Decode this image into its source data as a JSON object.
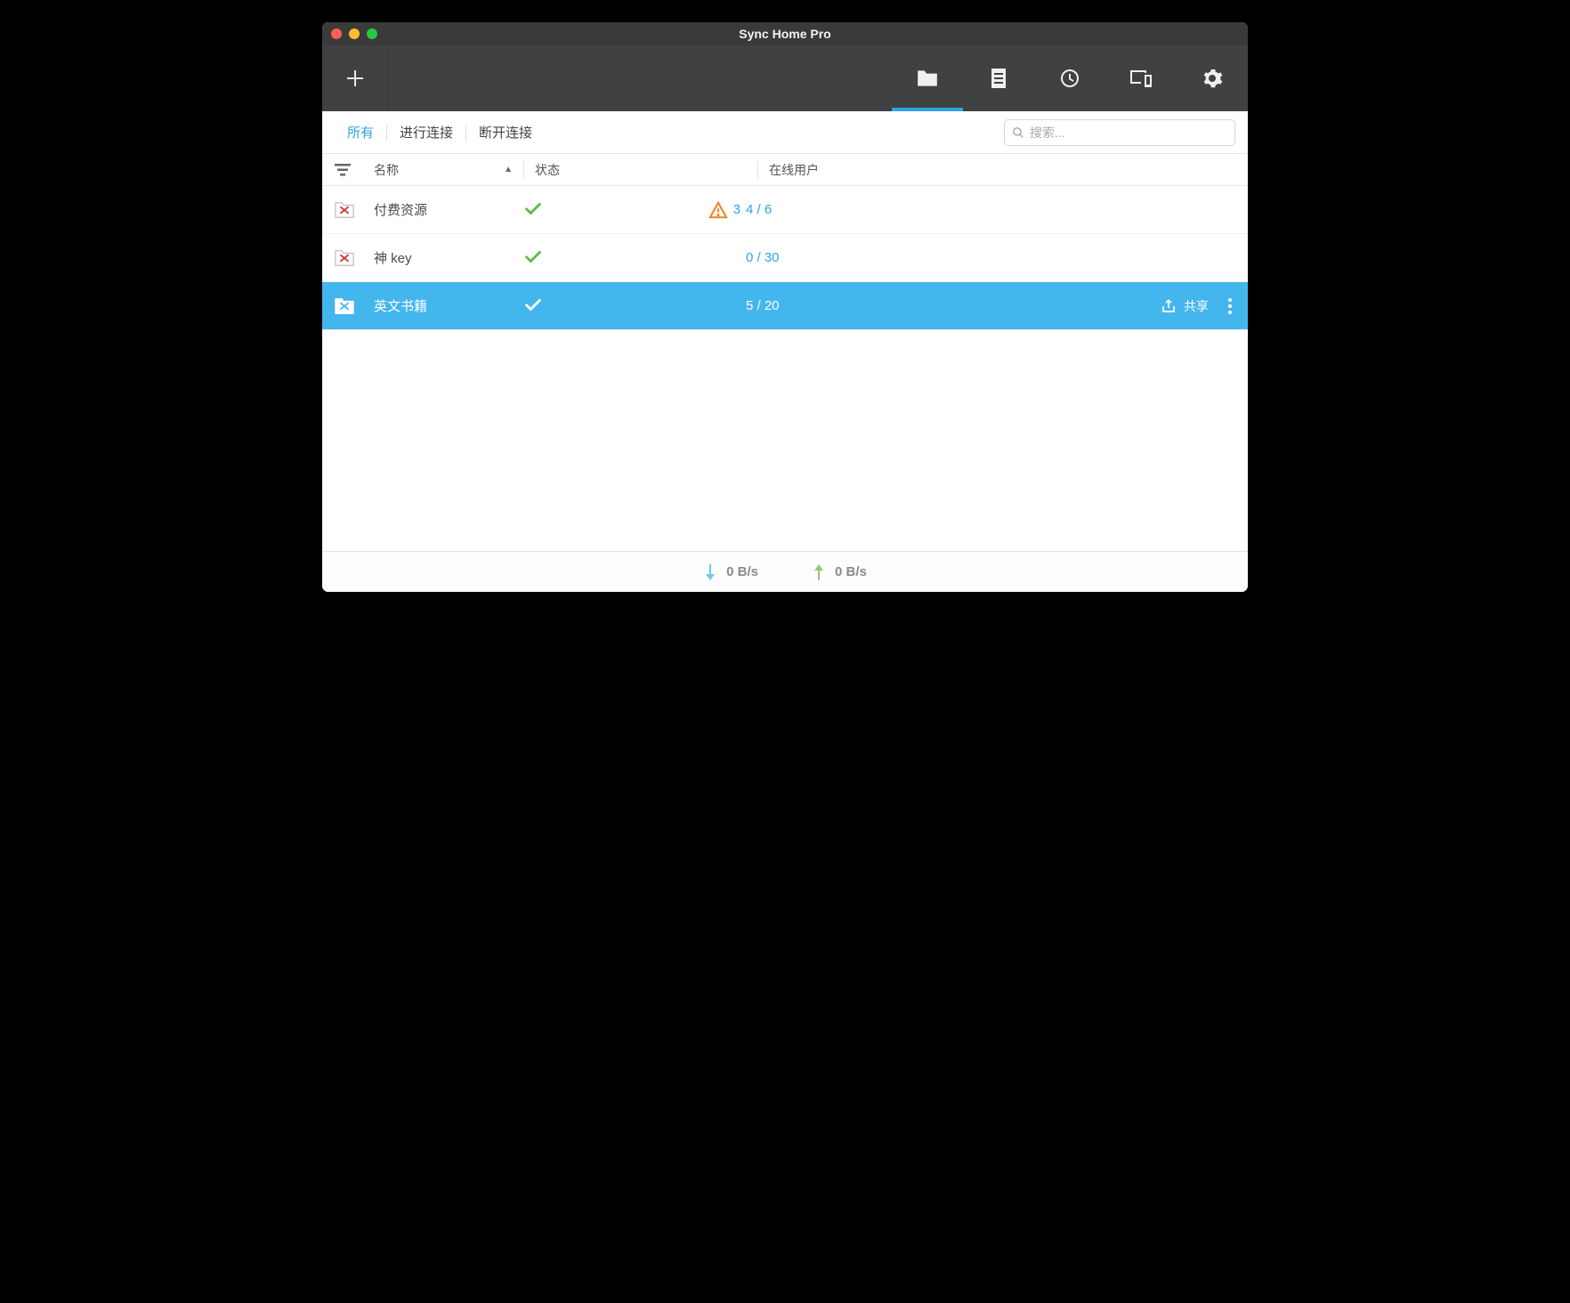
{
  "window": {
    "title": "Sync Home Pro"
  },
  "filters": {
    "all": "所有",
    "connecting": "进行连接",
    "disconnected": "断开连接"
  },
  "search": {
    "placeholder": "搜索..."
  },
  "headers": {
    "name": "名称",
    "status": "状态",
    "users": "在线用户"
  },
  "rows": [
    {
      "name": "付费资源",
      "warning_count": "3",
      "users": "4 / 6"
    },
    {
      "name": "神 key",
      "users": "0 / 30"
    },
    {
      "name": "英文书籍",
      "users": "5 / 20",
      "share": "共享"
    }
  ],
  "statusbar": {
    "down": "0 B/s",
    "up": "0 B/s"
  }
}
